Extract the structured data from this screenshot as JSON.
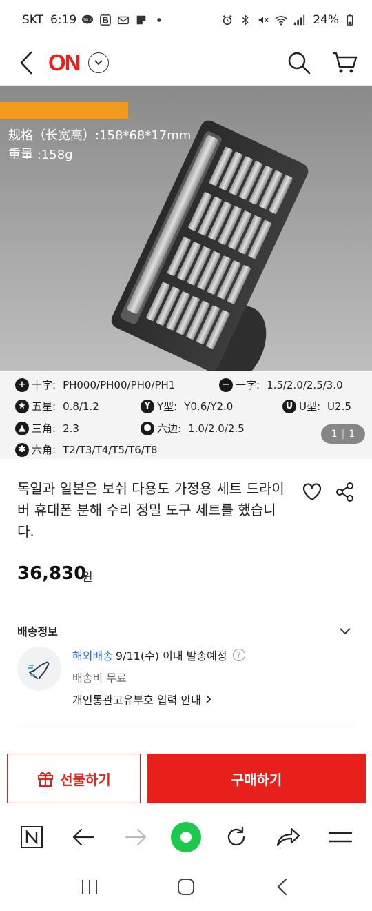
{
  "status_bar": {
    "carrier": "SKT",
    "time": "6:19",
    "talk_badge": "TALK",
    "battery": "24%"
  },
  "header": {
    "logo": "ON"
  },
  "product_image": {
    "spec_size": "规格（长宽高）:158*68*17mm",
    "spec_weight": "重量 :158g",
    "specs": [
      {
        "symbol": "+",
        "label": "十字:",
        "value": "PH000/PH00/PH0/PH1"
      },
      {
        "symbol": "−",
        "label": "一字:",
        "value": "1.5/2.0/2.5/3.0"
      },
      {
        "symbol": "★",
        "label": "五星:",
        "value": "0.8/1.2"
      },
      {
        "symbol": "Y",
        "label": "Y型:",
        "value": "Y0.6/Y2.0"
      },
      {
        "symbol": "U",
        "label": "U型:",
        "value": "U2.5"
      },
      {
        "symbol": "▲",
        "label": "三角:",
        "value": "2.3"
      },
      {
        "symbol": "⬢",
        "label": "六边:",
        "value": "1.0/2.0/2.5"
      },
      {
        "symbol": "✱",
        "label": "六角:",
        "value": "T2/T3/T4/T5/T6/T8"
      }
    ],
    "counter_current": "1",
    "counter_total": "1"
  },
  "product": {
    "title": "독일과 일본은 보쉬 다용도 가정용 세트 드라이버 휴대폰 분해 수리 정밀 도구 세트를 했습니다.",
    "price": "36,830",
    "price_unit": "원"
  },
  "shipping": {
    "section_title": "배송정보",
    "overseas_label": "해외배송",
    "schedule": "9/11(수) 이내 발송예정",
    "fee": "배송비 무료",
    "customs_link": "개인통관고유부호 입력 안내"
  },
  "actions": {
    "gift_label": "선물하기",
    "buy_label": "구매하기"
  },
  "colors": {
    "brand": "#e8201c",
    "overseas_link": "#2b6cd9",
    "browser_home": "#1bc94b",
    "accent_orange": "#f39a1c"
  }
}
